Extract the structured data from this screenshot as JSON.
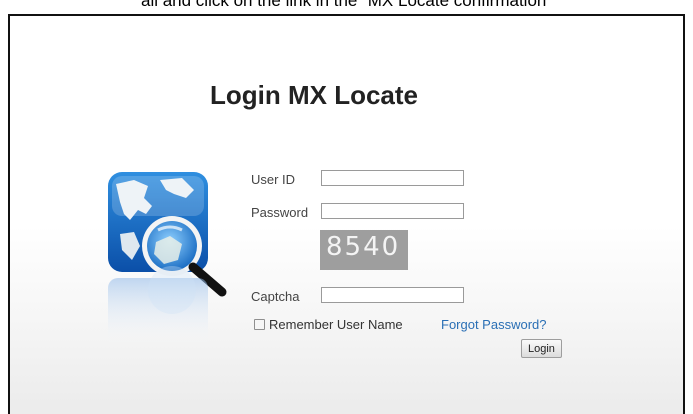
{
  "caption": "ail and click on the link in the “MX Locate confirmation”",
  "title": "Login MX Locate",
  "form": {
    "user_id_label": "User ID",
    "user_id_value": "",
    "password_label": "Password",
    "password_value": "",
    "captcha_image_text": "8540",
    "captcha_label": "Captcha",
    "captcha_value": "",
    "remember_label": "Remember User Name",
    "forgot_label": "Forgot Password?",
    "login_label": "Login"
  },
  "logo_icon": "globe-magnifier-icon",
  "colors": {
    "link": "#2a6fb5",
    "title": "#222222",
    "captcha_bg": "#9e9e9e"
  }
}
